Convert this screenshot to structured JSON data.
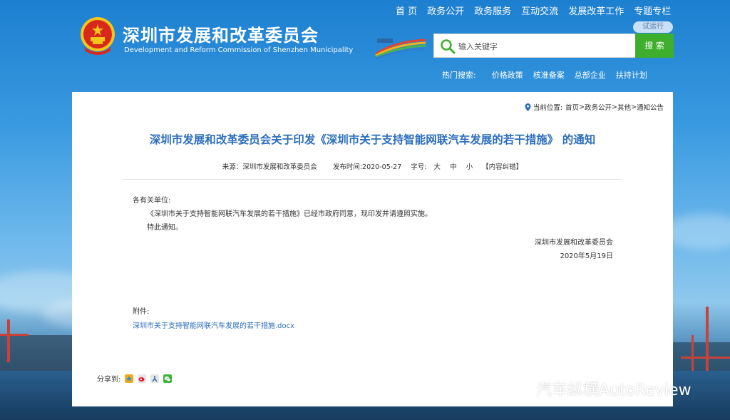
{
  "nav": {
    "items": [
      {
        "label": "首 页"
      },
      {
        "label": "政务公开"
      },
      {
        "label": "政务服务"
      },
      {
        "label": "互动交流"
      },
      {
        "label": "发展改革工作"
      },
      {
        "label": "专题专栏"
      }
    ]
  },
  "header": {
    "title": "深圳市发展和改革委员会",
    "subtitle": "Development and Reform Commission of Shenzhen Municipality",
    "trial_badge": "试运行"
  },
  "search": {
    "placeholder": "输入关键字",
    "button_label": "搜 索"
  },
  "hot_search": {
    "label": "热门搜索:",
    "items": [
      {
        "label": "价格政策"
      },
      {
        "label": "核准备案"
      },
      {
        "label": "总部企业"
      },
      {
        "label": "扶持计划"
      }
    ]
  },
  "breadcrumb": {
    "label": "当前位置:",
    "path": [
      "首页",
      "政务公开",
      "其他",
      "通知公告"
    ],
    "separator": " > "
  },
  "article": {
    "title": "深圳市发展和改革委员会关于印发《深圳市关于支持智能网联汽车发展的若干措施》 的通知",
    "meta": {
      "source": "来源：深圳市发展和改革委员会",
      "publish_time": "发布时间:2020-05-27",
      "font_size_label": "字号:",
      "size_large": "大",
      "size_medium": "中",
      "size_small": "小",
      "correction": "【内容纠错】"
    },
    "salutation": "各有关单位:",
    "body": "《深圳市关于支持智能网联汽车发展的若干措施》已经市政府同意，现印发并请遵照实施。",
    "closing": "特此通知。",
    "signature": "深圳市发展和改革委员会",
    "date": "2020年5月19日",
    "attachment_label": "附件:",
    "attachment_file": "深圳市关于支持智能网联汽车发展的若干措施.docx"
  },
  "share": {
    "label": "分享到:"
  },
  "watermark": {
    "text": "汽车纵横AutoReview"
  },
  "colors": {
    "title_blue": "#2c6ebd",
    "search_green": "#3daf2c",
    "link_blue": "#2c6ebd"
  }
}
